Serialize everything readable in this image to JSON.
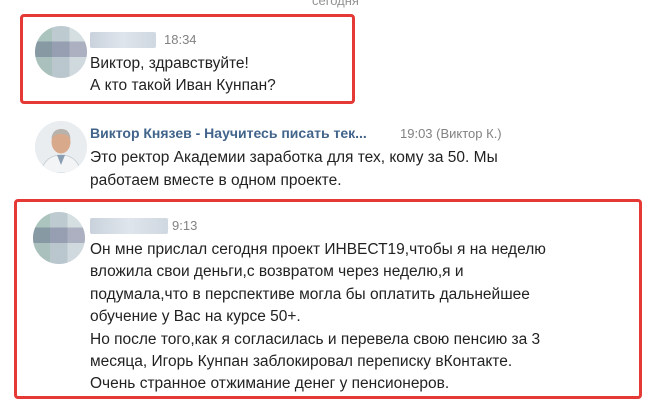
{
  "date_separator": "сегодня",
  "messages": [
    {
      "time": "18:34",
      "lines": [
        "Виктор, здравствуйте!",
        "А кто такой Иван Кунпан?"
      ]
    },
    {
      "author": "Виктор Князев - Научитесь писать тек...",
      "time": "19:03 (Виктор К.)",
      "lines": [
        "Это ректор Академии заработка для тех, кому за 50. Мы",
        "работаем вместе в одном проекте."
      ]
    },
    {
      "time": "9:13",
      "lines": [
        "Он мне прислал сегодня проект ИНВЕСТ19,чтобы я на неделю",
        "вложила свои деньги,с возвратом через неделю,я и",
        "подумала,что в перспективе могла бы оплатить дальнейшее",
        "обучение у Вас на курсе 50+.",
        "Но после того,как я согласилась и перевела свою пенсию за 3",
        "месяца, Игорь Кунпан заблокировал переписку вКонтакте.",
        "Очень странное отжимание денег у пенсионеров."
      ]
    }
  ],
  "colors": {
    "highlight": "#e53935",
    "author_link": "#42648b"
  }
}
